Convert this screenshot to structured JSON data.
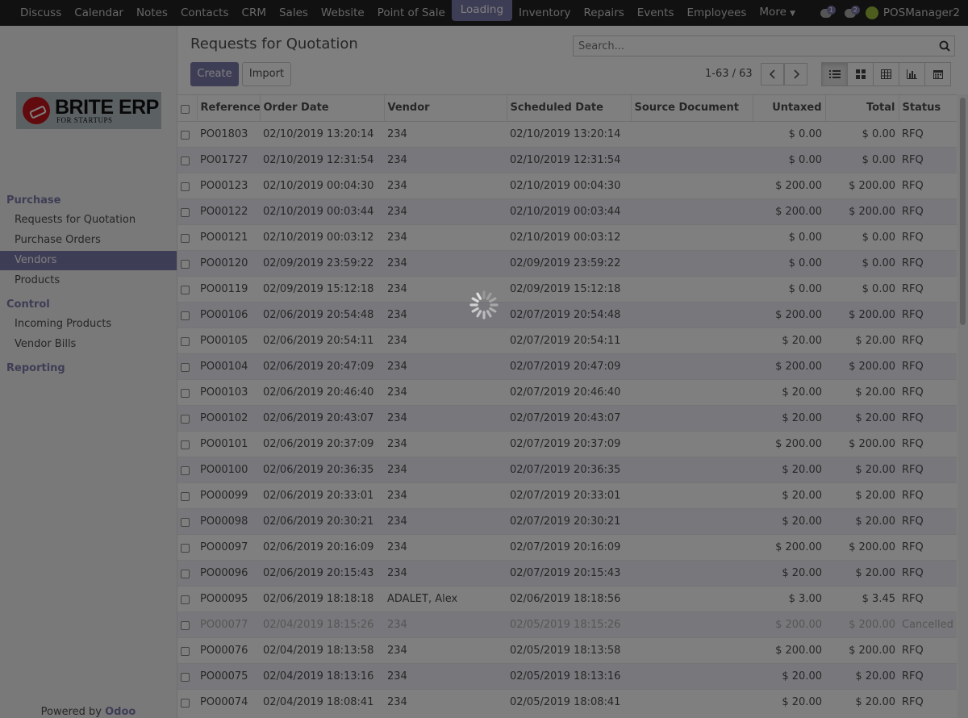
{
  "navbar": {
    "apps": [
      "Discuss",
      "Calendar",
      "Notes",
      "Contacts",
      "CRM",
      "Sales",
      "Website",
      "Point of Sale",
      "Loading",
      "Inventory",
      "Repairs",
      "Events",
      "Employees",
      "More"
    ],
    "activity_count": "1",
    "messages_count": "2",
    "user_name": "POSManager2"
  },
  "logo": {
    "main": "BRITE ERP",
    "sub": "FOR STARTUPS"
  },
  "sidebar": {
    "section_purchase": "Purchase",
    "rfq": "Requests for Quotation",
    "purchase_orders": "Purchase Orders",
    "vendors": "Vendors",
    "products": "Products",
    "section_control": "Control",
    "incoming_products": "Incoming Products",
    "vendor_bills": "Vendor Bills",
    "section_reporting": "Reporting",
    "powered_prefix": "Powered by ",
    "powered_brand": "Odoo"
  },
  "control_panel": {
    "title": "Requests for Quotation",
    "search_placeholder": "Search...",
    "create_label": "Create",
    "import_label": "Import",
    "pager": "1-63 / 63"
  },
  "table": {
    "headers": [
      "Reference",
      "Order Date",
      "Vendor",
      "Scheduled Date",
      "Source Document",
      "Untaxed",
      "Total",
      "Status"
    ],
    "rows": [
      [
        "PO01803",
        "02/10/2019 13:20:14",
        "234",
        "02/10/2019 13:20:14",
        "",
        "$ 0.00",
        "$ 0.00",
        "RFQ"
      ],
      [
        "PO01727",
        "02/10/2019 12:31:54",
        "234",
        "02/10/2019 12:31:54",
        "",
        "$ 0.00",
        "$ 0.00",
        "RFQ"
      ],
      [
        "PO00123",
        "02/10/2019 00:04:30",
        "234",
        "02/10/2019 00:04:30",
        "",
        "$ 200.00",
        "$ 200.00",
        "RFQ"
      ],
      [
        "PO00122",
        "02/10/2019 00:03:44",
        "234",
        "02/10/2019 00:03:44",
        "",
        "$ 200.00",
        "$ 200.00",
        "RFQ"
      ],
      [
        "PO00121",
        "02/10/2019 00:03:12",
        "234",
        "02/10/2019 00:03:12",
        "",
        "$ 0.00",
        "$ 0.00",
        "RFQ"
      ],
      [
        "PO00120",
        "02/09/2019 23:59:22",
        "234",
        "02/09/2019 23:59:22",
        "",
        "$ 0.00",
        "$ 0.00",
        "RFQ"
      ],
      [
        "PO00119",
        "02/09/2019 15:12:18",
        "234",
        "02/09/2019 15:12:18",
        "",
        "$ 0.00",
        "$ 0.00",
        "RFQ"
      ],
      [
        "PO00106",
        "02/06/2019 20:54:48",
        "234",
        "02/07/2019 20:54:48",
        "",
        "$ 200.00",
        "$ 200.00",
        "RFQ"
      ],
      [
        "PO00105",
        "02/06/2019 20:54:11",
        "234",
        "02/07/2019 20:54:11",
        "",
        "$ 20.00",
        "$ 20.00",
        "RFQ"
      ],
      [
        "PO00104",
        "02/06/2019 20:47:09",
        "234",
        "02/07/2019 20:47:09",
        "",
        "$ 200.00",
        "$ 200.00",
        "RFQ"
      ],
      [
        "PO00103",
        "02/06/2019 20:46:40",
        "234",
        "02/07/2019 20:46:40",
        "",
        "$ 20.00",
        "$ 20.00",
        "RFQ"
      ],
      [
        "PO00102",
        "02/06/2019 20:43:07",
        "234",
        "02/07/2019 20:43:07",
        "",
        "$ 20.00",
        "$ 20.00",
        "RFQ"
      ],
      [
        "PO00101",
        "02/06/2019 20:37:09",
        "234",
        "02/07/2019 20:37:09",
        "",
        "$ 200.00",
        "$ 200.00",
        "RFQ"
      ],
      [
        "PO00100",
        "02/06/2019 20:36:35",
        "234",
        "02/07/2019 20:36:35",
        "",
        "$ 20.00",
        "$ 20.00",
        "RFQ"
      ],
      [
        "PO00099",
        "02/06/2019 20:33:01",
        "234",
        "02/07/2019 20:33:01",
        "",
        "$ 20.00",
        "$ 20.00",
        "RFQ"
      ],
      [
        "PO00098",
        "02/06/2019 20:30:21",
        "234",
        "02/07/2019 20:30:21",
        "",
        "$ 20.00",
        "$ 20.00",
        "RFQ"
      ],
      [
        "PO00097",
        "02/06/2019 20:16:09",
        "234",
        "02/07/2019 20:16:09",
        "",
        "$ 200.00",
        "$ 200.00",
        "RFQ"
      ],
      [
        "PO00096",
        "02/06/2019 20:15:43",
        "234",
        "02/07/2019 20:15:43",
        "",
        "$ 20.00",
        "$ 20.00",
        "RFQ"
      ],
      [
        "PO00095",
        "02/06/2019 18:18:18",
        "ADALET, Alex",
        "02/06/2019 18:18:56",
        "",
        "$ 3.00",
        "$ 3.45",
        "RFQ"
      ],
      [
        "PO00077",
        "02/04/2019 18:15:26",
        "234",
        "02/05/2019 18:15:26",
        "",
        "$ 200.00",
        "$ 200.00",
        "Cancelled"
      ],
      [
        "PO00076",
        "02/04/2019 18:13:58",
        "234",
        "02/05/2019 18:13:58",
        "",
        "$ 200.00",
        "$ 200.00",
        "RFQ"
      ],
      [
        "PO00075",
        "02/04/2019 18:13:16",
        "234",
        "02/05/2019 18:13:16",
        "",
        "$ 20.00",
        "$ 20.00",
        "RFQ"
      ],
      [
        "PO00074",
        "02/04/2019 18:08:41",
        "234",
        "02/05/2019 18:08:41",
        "",
        "$ 20.00",
        "$ 20.00",
        "RFQ"
      ]
    ]
  },
  "colors": {
    "brand": "#7c7bad",
    "navbar": "#222222",
    "overlay": "rgba(0,0,0,0.5)"
  },
  "icons": [
    "search-icon",
    "chevron-left-icon",
    "chevron-right-icon",
    "list-view-icon",
    "kanban-view-icon",
    "grid-view-icon",
    "graph-view-icon",
    "calendar-view-icon",
    "spinner-icon"
  ]
}
